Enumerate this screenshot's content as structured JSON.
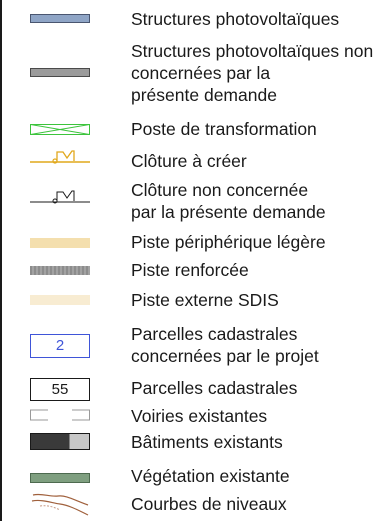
{
  "legend": {
    "items": [
      {
        "key": "pv_structures",
        "lines": [
          "Structures photovoltaïques"
        ],
        "color": "#8fa5c6"
      },
      {
        "key": "pv_structures_not_concerned",
        "lines": [
          "Structures photovoltaïques non",
          "concernées par la",
          "présente demande"
        ],
        "color": "#9b9b9b"
      },
      {
        "key": "transformer_station",
        "lines": [
          "Poste de transformation"
        ],
        "color": "#3cc43c"
      },
      {
        "key": "fence_to_create",
        "lines": [
          "Clôture à créer"
        ],
        "color": "#e1a81c"
      },
      {
        "key": "fence_not_concerned",
        "lines": [
          "Clôture non concernée",
          "par la présente demande"
        ],
        "color": "#1a1a1a"
      },
      {
        "key": "light_perimeter_track",
        "lines": [
          "Piste périphérique légère"
        ],
        "color": "#f4dfae"
      },
      {
        "key": "reinforced_track",
        "lines": [
          "Piste renforcée"
        ],
        "color": "#8c8c8c"
      },
      {
        "key": "sdis_external_track",
        "lines": [
          "Piste externe SDIS"
        ],
        "color": "#f8ecd2"
      },
      {
        "key": "project_parcels",
        "lines": [
          "Parcelles cadastrales",
          "concernées par le projet"
        ],
        "color": "#3f55d8",
        "badge": "2"
      },
      {
        "key": "cadastral_parcels",
        "lines": [
          "Parcelles cadastrales"
        ],
        "color": "#1a1a1a",
        "badge": "55"
      },
      {
        "key": "existing_roads",
        "lines": [
          "Voiries existantes"
        ],
        "color": "#9a9a9a"
      },
      {
        "key": "existing_buildings",
        "lines": [
          "Bâtiments existants"
        ],
        "color": "#3a3a3a"
      },
      {
        "key": "existing_vegetation",
        "lines": [
          "Végétation existante"
        ],
        "color": "#7f9f80"
      },
      {
        "key": "contour_lines",
        "lines": [
          "Courbes de niveaux"
        ],
        "color": "#a0603c"
      }
    ]
  }
}
